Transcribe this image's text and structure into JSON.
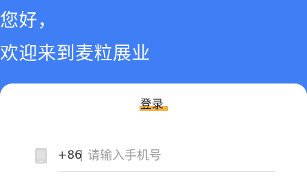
{
  "header": {
    "greeting": "您好，",
    "welcome": "欢迎来到麦粒展业"
  },
  "login": {
    "tab_label": "登录",
    "phone": {
      "icon": "phone-icon",
      "country_code": "+86",
      "divider": "|",
      "placeholder": "请输入手机号",
      "value": ""
    }
  },
  "colors": {
    "primary": "#3f7ef4",
    "accent": "#f0b247",
    "card_background": "#ffffff"
  }
}
